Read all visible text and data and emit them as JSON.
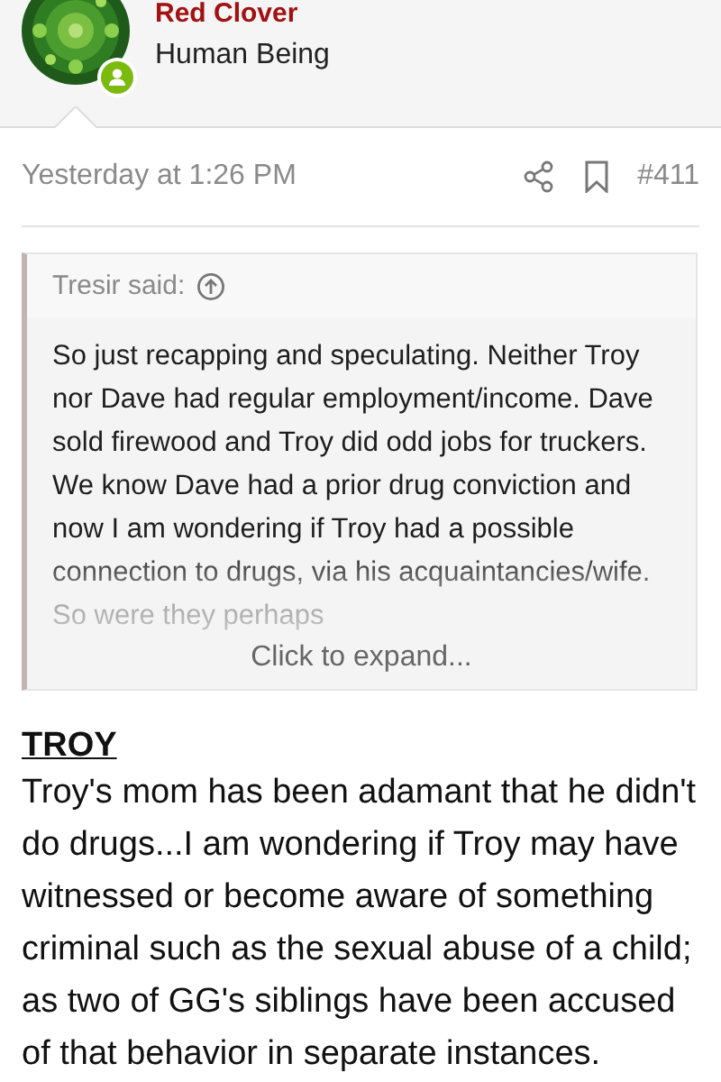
{
  "author": {
    "name": "Red Clover",
    "title": "Human Being",
    "online": true
  },
  "post": {
    "time": "Yesterday at 1:26 PM",
    "number": "#411",
    "quote": {
      "attribution": "Tresir said:",
      "text": "So just recapping and speculating. Neither Troy nor Dave had regular employment/income. Dave sold firewood and Troy did odd jobs for truckers. We know Dave had a prior drug conviction and now I am wondering if Troy had a possible connection to drugs, via his acquaintancies/wife. So were they perhaps",
      "expand": "Click to expand..."
    },
    "heading": "TROY",
    "body": "Troy's mom has been adamant that he didn't do drugs...I am wondering if Troy may have witnessed or become aware of something criminal such as the sexual abuse of a child; as two of GG's siblings have been accused of that behavior in separate instances."
  }
}
